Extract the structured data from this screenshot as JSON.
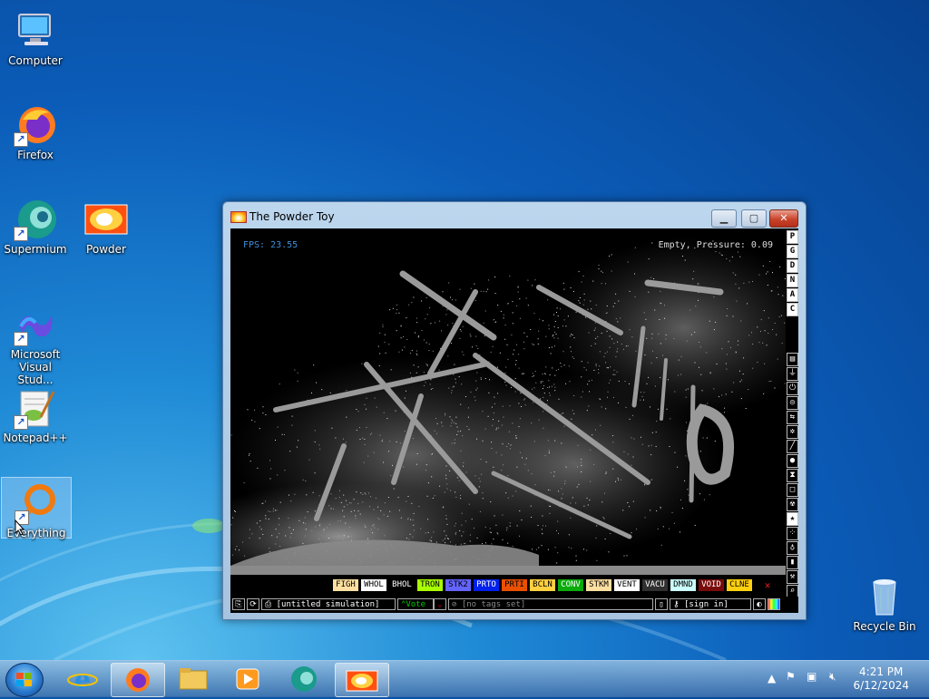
{
  "desktop": {
    "icons": [
      {
        "label": "Computer"
      },
      {
        "label": "Firefox"
      },
      {
        "label": "Supermium"
      },
      {
        "label": "Powder"
      },
      {
        "label": "Microsoft Visual Stud..."
      },
      {
        "label": "Notepad++"
      },
      {
        "label": "Everything"
      },
      {
        "label": "Recycle Bin"
      }
    ]
  },
  "window": {
    "title": "The Powder Toy",
    "fps": "FPS: 23.55",
    "status": "Empty, Pressure: 0.09",
    "right_menu_letters": [
      "P",
      "G",
      "D",
      "N",
      "A",
      "C"
    ],
    "categories": [
      "walls",
      "electronics",
      "powered",
      "force",
      "explosives",
      "gases",
      "liquids",
      "powders",
      "solids",
      "radioactive",
      "special",
      "life",
      "tools",
      "favorites",
      "search"
    ],
    "elements": [
      {
        "name": "FIGH",
        "color": "#ffe0a0",
        "text": "#000"
      },
      {
        "name": "WHOL",
        "color": "#ffffff",
        "text": "#000"
      },
      {
        "name": "BHOL",
        "color": "#000000",
        "text": "#fff"
      },
      {
        "name": "TRON",
        "color": "#a9ff00",
        "text": "#000"
      },
      {
        "name": "STK2",
        "color": "#6464ff",
        "text": "#000"
      },
      {
        "name": "PRTO",
        "color": "#0020eb",
        "text": "#fff"
      },
      {
        "name": "PRTI",
        "color": "#eb5000",
        "text": "#000"
      },
      {
        "name": "BCLN",
        "color": "#ffd040",
        "text": "#000"
      },
      {
        "name": "CONV",
        "color": "#0aab0a",
        "text": "#fff"
      },
      {
        "name": "STKM",
        "color": "#ffe0a0",
        "text": "#000"
      },
      {
        "name": "VENT",
        "color": "#ffffff",
        "text": "#000"
      },
      {
        "name": "VACU",
        "color": "#303030",
        "text": "#fff"
      },
      {
        "name": "DMND",
        "color": "#ccffff",
        "text": "#000"
      },
      {
        "name": "VOID",
        "color": "#790b0b",
        "text": "#fff"
      },
      {
        "name": "CLNE",
        "color": "#ffd010",
        "text": "#000"
      }
    ],
    "close_glyph": "✕",
    "bottom": {
      "save_name": "[untitled simulation]",
      "vote": "Vote",
      "tags": "[no tags set]",
      "signin": "[sign in]"
    }
  },
  "taskbar": {
    "time": "4:21 PM",
    "date": "6/12/2024"
  }
}
